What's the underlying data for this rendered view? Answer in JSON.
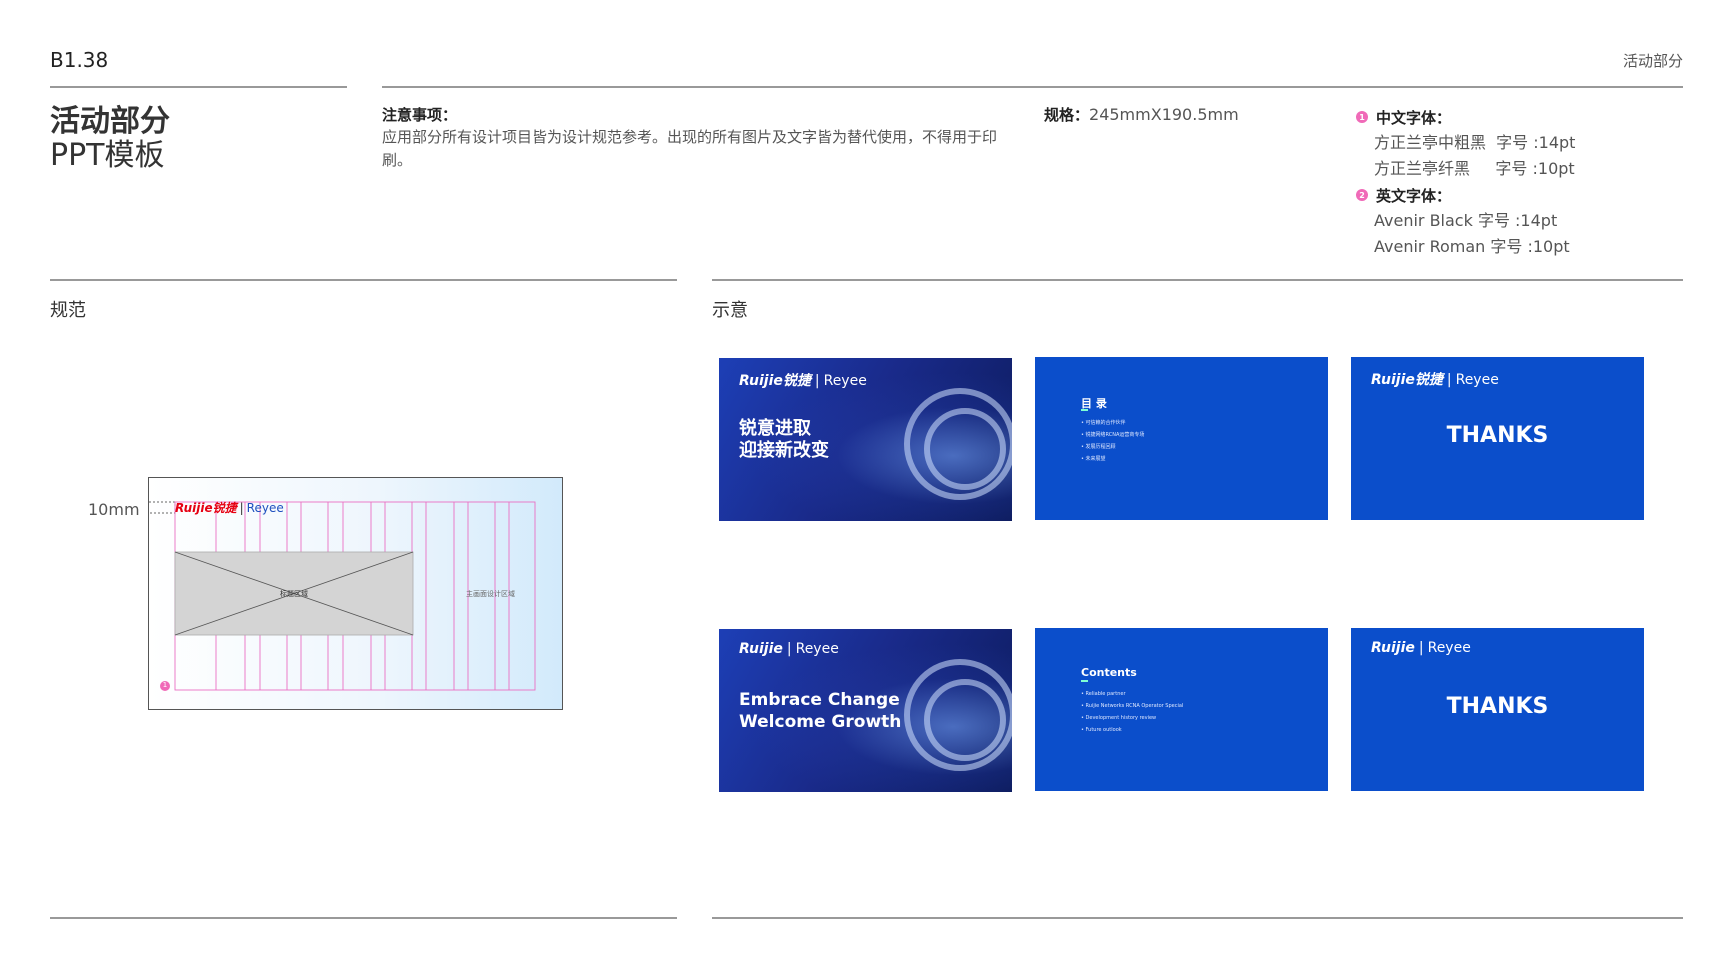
{
  "header": {
    "code": "B1.38",
    "section": "活动部分"
  },
  "title": {
    "line1": "活动部分",
    "line2": "PPT模板"
  },
  "notes": {
    "title": "注意事项：",
    "body": "应用部分所有设计项目皆为设计规范参考。出现的所有图片及文字皆为替代使用，不得用于印刷。"
  },
  "spec": {
    "label": "规格：",
    "value": "245mmX190.5mm"
  },
  "fonts": {
    "chinese": {
      "num": "1",
      "title": "中文字体：",
      "lines": [
        "方正兰亭中粗黑  字号 :14pt",
        "方正兰亭纤黑     字号 :10pt"
      ]
    },
    "english": {
      "num": "2",
      "title": "英文字体：",
      "lines": [
        "Avenir Black 字号 :14pt",
        "Avenir Roman 字号 :10pt"
      ]
    }
  },
  "left_panel": {
    "label": "规范",
    "margin_label": "10mm",
    "title_area": "标题区域",
    "main_image_area": "主画面设计区域",
    "marker": "1",
    "logo_main": "Ruijie锐捷",
    "logo_sub": "Reyee"
  },
  "right_panel": {
    "label": "示意"
  },
  "slides": {
    "logo_cn": "Ruijie锐捷",
    "logo_en": "Ruijie",
    "logo_sub": "Reyee",
    "cover_cn": [
      "锐意进取",
      "迎接新改变"
    ],
    "cover_en": [
      "Embrace Change",
      "Welcome Growth"
    ],
    "toc_cn": {
      "title": "目 录",
      "items": [
        "可信赖的合作伙伴",
        "锐捷网络RCNA运营商专场",
        "发展历程回顾",
        "未来展望"
      ]
    },
    "toc_en": {
      "title": "Contents",
      "items": [
        "Reliable partner",
        "Ruijie Networks RCNA Operator Special",
        "Development history review",
        "Future outlook"
      ]
    },
    "thanks": "THANKS"
  },
  "colors": {
    "slide_blue": "#0b4ecb",
    "accent_pink": "#f06ab8",
    "logo_red": "#e60012"
  }
}
